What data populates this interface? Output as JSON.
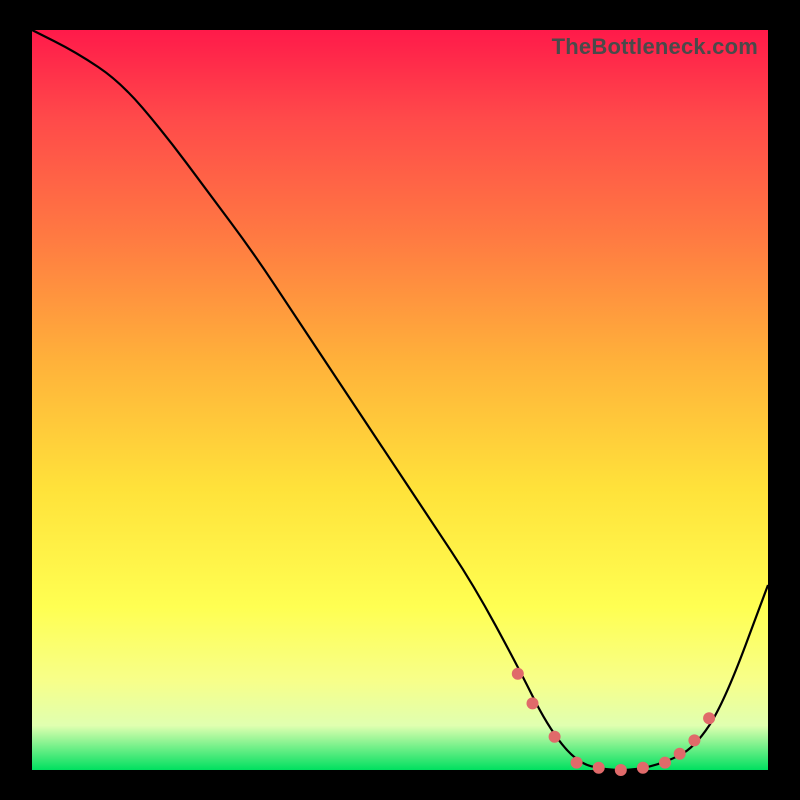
{
  "watermark": "TheBottleneck.com",
  "chart_data": {
    "type": "line",
    "title": "",
    "xlabel": "",
    "ylabel": "",
    "xlim": [
      0,
      100
    ],
    "ylim": [
      0,
      100
    ],
    "series": [
      {
        "name": "bottleneck-curve",
        "x": [
          0,
          6,
          12,
          18,
          24,
          30,
          36,
          42,
          48,
          54,
          60,
          66,
          70,
          74,
          78,
          82,
          86,
          90,
          94,
          100
        ],
        "y": [
          100,
          97,
          93,
          86,
          78,
          70,
          61,
          52,
          43,
          34,
          25,
          14,
          6,
          1,
          0,
          0,
          1,
          3,
          9,
          25
        ]
      }
    ],
    "markers": {
      "name": "highlight-dots",
      "x": [
        66,
        68,
        71,
        74,
        77,
        80,
        83,
        86,
        88,
        90,
        92
      ],
      "y": [
        13,
        9,
        4.5,
        1,
        0.3,
        0,
        0.3,
        1,
        2.2,
        4,
        7
      ]
    }
  }
}
